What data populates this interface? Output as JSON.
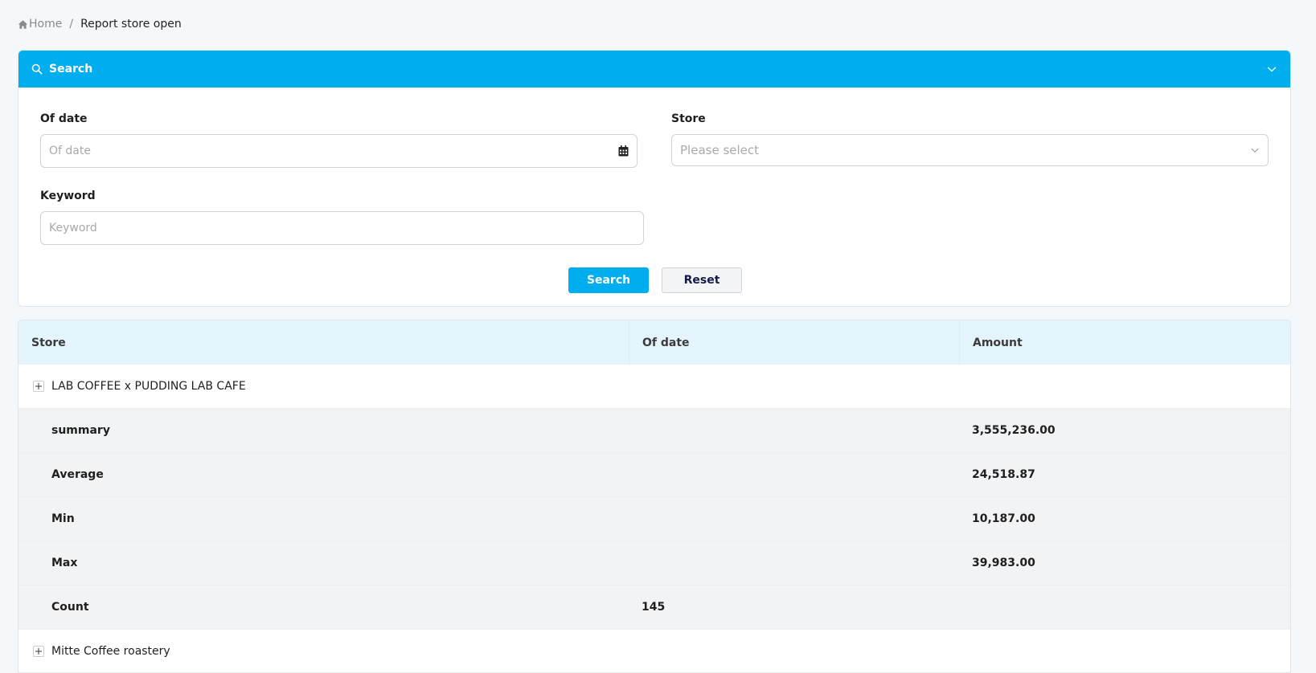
{
  "breadcrumb": {
    "home": "Home",
    "separator": "/",
    "current": "Report store open"
  },
  "search": {
    "title": "Search",
    "of_date_label": "Of date",
    "of_date_placeholder": "Of date",
    "store_label": "Store",
    "store_placeholder": "Please select",
    "keyword_label": "Keyword",
    "keyword_placeholder": "Keyword",
    "search_button": "Search",
    "reset_button": "Reset"
  },
  "table": {
    "columns": [
      "Store",
      "Of date",
      "Amount"
    ],
    "groups": [
      {
        "store": "LAB COFFEE x PUDDING LAB CAFE",
        "stats": [
          {
            "label": "summary",
            "of_date": "",
            "amount": "3,555,236.00"
          },
          {
            "label": "Average",
            "of_date": "",
            "amount": "24,518.87"
          },
          {
            "label": "Min",
            "of_date": "",
            "amount": "10,187.00"
          },
          {
            "label": "Max",
            "of_date": "",
            "amount": "39,983.00"
          },
          {
            "label": "Count",
            "of_date": "145",
            "amount": ""
          }
        ]
      },
      {
        "store": "Mitte Coffee roastery"
      }
    ]
  },
  "colors": {
    "accent": "#00aeef",
    "header_bg": "#e4f4fc",
    "stat_row_bg": "#f2f3f5"
  }
}
